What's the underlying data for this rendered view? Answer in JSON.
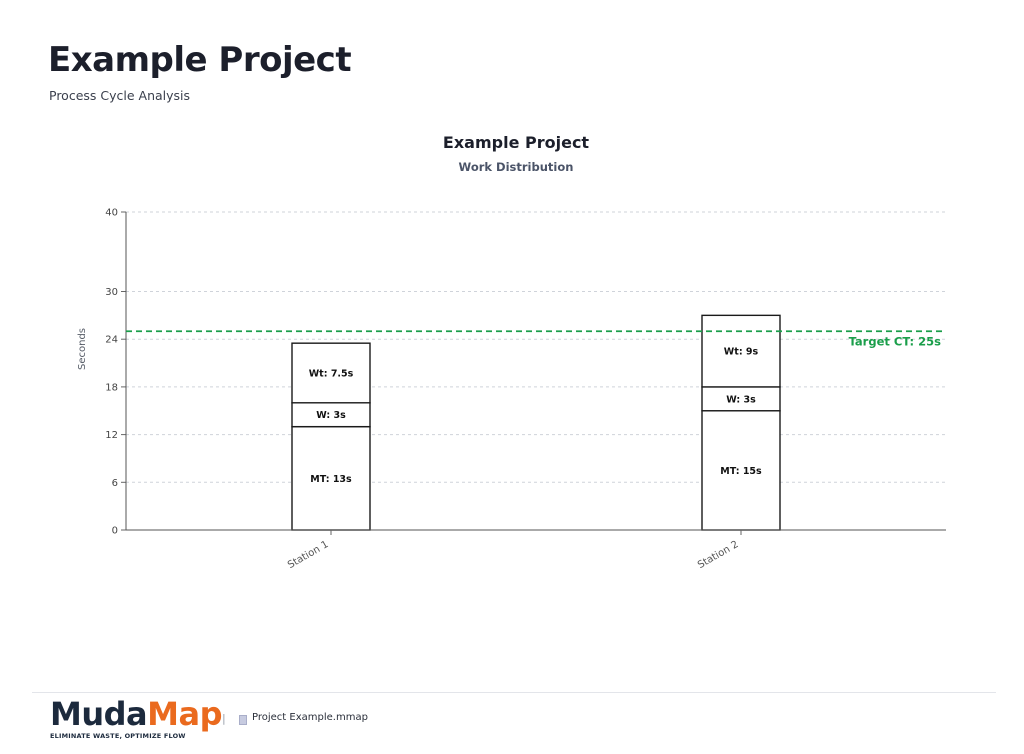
{
  "header": {
    "title": "Example Project",
    "subtitle": "Process Cycle Analysis"
  },
  "chart_data": {
    "type": "bar",
    "stacked": true,
    "title": "Example Project",
    "subtitle": "Work Distribution",
    "xlabel": "",
    "ylabel": "Seconds",
    "ylim": [
      0,
      40
    ],
    "yticks": [
      0,
      6,
      12,
      18,
      24,
      30,
      40
    ],
    "grid": true,
    "categories": [
      "Station 1",
      "Station 2"
    ],
    "series": [
      {
        "key": "MT",
        "values": [
          13,
          15
        ],
        "labels": [
          "MT: 13s",
          "MT: 15s"
        ]
      },
      {
        "key": "W",
        "values": [
          3,
          3
        ],
        "labels": [
          "W: 3s",
          "W: 3s"
        ]
      },
      {
        "key": "Wt",
        "values": [
          7.5,
          9
        ],
        "labels": [
          "Wt: 7.5s",
          "Wt: 9s"
        ]
      }
    ],
    "target": {
      "value": 25,
      "label": "Target CT: 25s",
      "color": "#1a9e4a"
    }
  },
  "footer": {
    "logo_text_1": "Muda",
    "logo_text_2": "Map",
    "tagline": "ELIMINATE WASTE, OPTIMIZE FLOW",
    "separator": "|",
    "file_name": "Project Example.mmap"
  },
  "colors": {
    "brand_dark": "#1c2a3d",
    "brand_orange": "#ea6a1e",
    "target_green": "#1a9e4a"
  }
}
